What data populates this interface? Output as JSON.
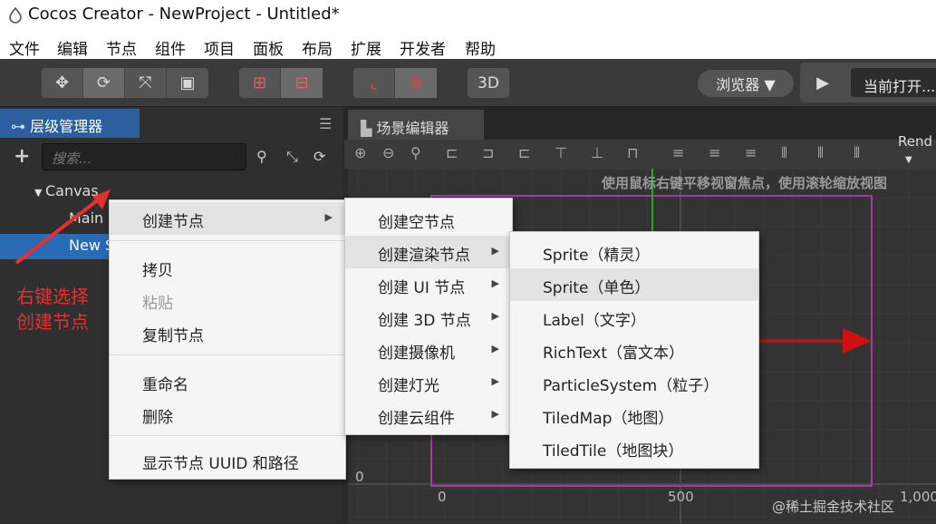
{
  "window": {
    "title": "Cocos Creator - NewProject - Untitled*"
  },
  "menubar": [
    "文件",
    "编辑",
    "节点",
    "组件",
    "项目",
    "面板",
    "布局",
    "扩展",
    "开发者",
    "帮助"
  ],
  "toolbar": {
    "btn_3d": "3D",
    "preview_dropdown": "浏览器 ▼",
    "current_open": "当前打开..."
  },
  "hierarchy": {
    "tab_label": "层级管理器",
    "search_placeholder": "搜索...",
    "tree": {
      "canvas": "Canvas",
      "main": "Main",
      "new_node": "New S"
    }
  },
  "annotation": {
    "line1": "右键选择",
    "line2": "创建节点"
  },
  "scene": {
    "tab_label": "场景编辑器",
    "hint": "使用鼠标右键平移视窗焦点，使用滚轮缩放视图",
    "render_label": "Rend",
    "ticks": {
      "y0": "0",
      "x0": "0",
      "x500": "500",
      "x1000": "1,000"
    }
  },
  "context_menu": {
    "items": [
      "创建节点",
      "拷贝",
      "粘贴",
      "复制节点",
      "重命名",
      "删除",
      "显示节点 UUID 和路径"
    ]
  },
  "create_submenu": {
    "items": [
      "创建空节点",
      "创建渲染节点",
      "创建 UI 节点",
      "创建 3D 节点",
      "创建摄像机",
      "创建灯光",
      "创建云组件"
    ]
  },
  "render_submenu": {
    "items": [
      "Sprite（精灵）",
      "Sprite（单色）",
      "Label（文字）",
      "RichText（富文本）",
      "ParticleSystem（粒子）",
      "TiledMap（地图）",
      "TiledTile（地图块）"
    ]
  },
  "watermark": "@稀土掘金技术社区",
  "colors": {
    "accent_blue": "#2c5f9e",
    "selection_blue": "#2a6bb5",
    "annotation_red": "#e53030",
    "gizmo_red": "#cc1111",
    "canvas_border": "#a83aa8"
  }
}
